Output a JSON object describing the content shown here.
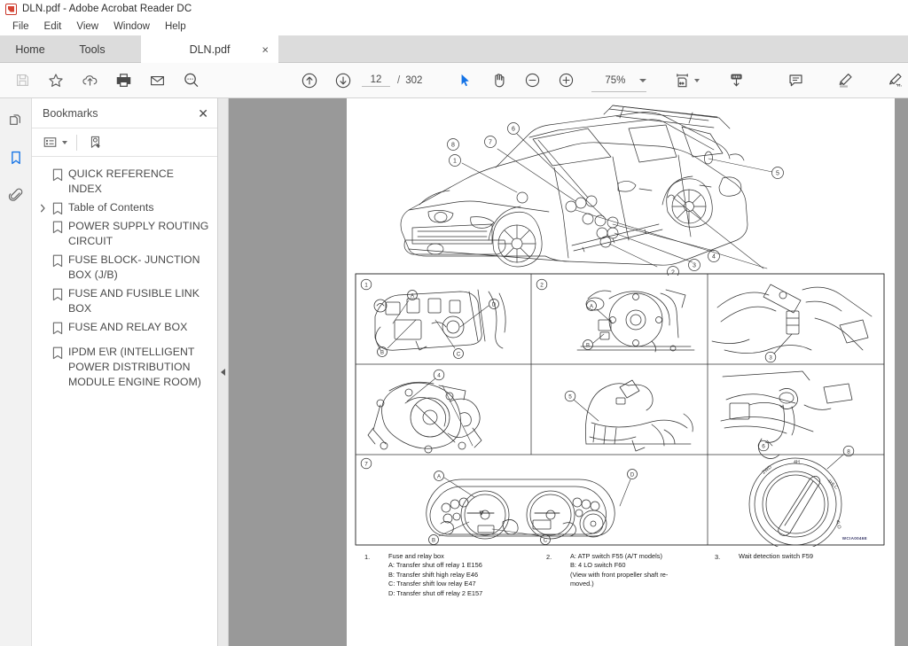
{
  "window": {
    "title": "DLN.pdf - Adobe Acrobat Reader DC",
    "app_icon": "pdf-icon"
  },
  "menubar": {
    "items": [
      {
        "label": "File"
      },
      {
        "label": "Edit"
      },
      {
        "label": "View"
      },
      {
        "label": "Window"
      },
      {
        "label": "Help"
      }
    ]
  },
  "tabs": {
    "home": "Home",
    "tools": "Tools",
    "document": "DLN.pdf",
    "close_glyph": "×"
  },
  "toolbar": {
    "left_icons": [
      {
        "name": "save-icon",
        "title": "Save File"
      },
      {
        "name": "star-icon",
        "title": "Add to Favorites"
      },
      {
        "name": "cloud-upload-icon",
        "title": "Save to Cloud"
      },
      {
        "name": "print-icon",
        "title": "Print File"
      },
      {
        "name": "email-icon",
        "title": "Send File by Email"
      },
      {
        "name": "search-icon",
        "title": "Find"
      }
    ],
    "prev_page": "previous-page-icon",
    "next_page": "next-page-icon",
    "page_current": "12",
    "page_separator": "/",
    "page_total": "302",
    "select_tool": "select-cursor-icon",
    "hand_tool": "hand-tool-icon",
    "zoom_out": "zoom-out-icon",
    "zoom_in": "zoom-in-icon",
    "zoom_level": "75%",
    "page_fit": "page-fit-icon",
    "scroll_mode": "scroll-mode-icon",
    "comment": "comment-icon",
    "highlight": "highlight-icon",
    "sign": "sign-icon",
    "fill_sign": "fill-and-sign-icon"
  },
  "navrail": {
    "items": [
      {
        "name": "page-thumbnails-icon",
        "label": "Page Thumbnails",
        "active": false
      },
      {
        "name": "bookmarks-icon",
        "label": "Bookmarks",
        "active": true
      },
      {
        "name": "attachments-icon",
        "label": "Attachments",
        "active": false
      }
    ]
  },
  "bookmarks_panel": {
    "title": "Bookmarks",
    "close_glyph": "✕",
    "options_icon": "bookmark-options-icon",
    "new_bookmark_icon": "new-bookmark-icon",
    "items": [
      {
        "label": "QUICK REFERENCE INDEX",
        "expandable": false
      },
      {
        "label": "Table of Contents",
        "expandable": true
      },
      {
        "label": "POWER SUPPLY ROUTING CIRCUIT",
        "expandable": false
      },
      {
        "label": "FUSE BLOCK- JUNCTION BOX (J/B)",
        "expandable": false
      },
      {
        "label": "FUSE AND FUSIBLE LINK BOX",
        "expandable": false
      },
      {
        "label": "FUSE AND RELAY BOX",
        "expandable": false
      },
      {
        "label": "IPDM E\\R (INTELLIGENT POWER DISTRIBUTION MODULE ENGINE ROOM)",
        "expandable": false
      }
    ],
    "collapse_handle": "panel-collapse-handle"
  },
  "document": {
    "figure_code": "WCIA0046E",
    "vehicle_callouts": [
      "1",
      "2",
      "3",
      "4",
      "5",
      "6",
      "7",
      "8"
    ],
    "grid_cells": [
      {
        "number": "1",
        "sublabels": [
          "A",
          "B",
          "C",
          "D"
        ]
      },
      {
        "number": "2",
        "sublabels": [
          "A",
          "B"
        ]
      },
      {
        "number": "3",
        "sublabels": []
      },
      {
        "number": "4",
        "sublabels": []
      },
      {
        "number": "5",
        "sublabels": []
      },
      {
        "number": "6",
        "sublabels": []
      },
      {
        "number": "7",
        "sublabels": [
          "A",
          "B",
          "C",
          "D"
        ]
      },
      {
        "number": "8",
        "sublabels": []
      }
    ],
    "caption": {
      "columns": [
        {
          "number": "1.",
          "lines": [
            "Fuse and relay box",
            "A: Transfer shut off relay 1 E156",
            "B: Transfer shift high relay E46",
            "C: Transfer shift low relay E47",
            "D: Transfer shut off relay 2 E157"
          ]
        },
        {
          "number": "2.",
          "lines": [
            "A: ATP switch F55 (A/T models)",
            "B: 4 LO switch F60",
            "(View with front propeller shaft re-",
            "moved.)"
          ]
        },
        {
          "number": "3.",
          "lines": [
            "Wait detection switch F59"
          ]
        }
      ]
    }
  },
  "colors": {
    "accent": "#1473e6",
    "toolbar_bg": "#fafafa",
    "tabbar_bg": "#dcdcdc",
    "viewer_bg": "#999999",
    "page_bg": "#ffffff",
    "icon_grey": "#5a5a5a",
    "text_grey": "#4a4a4a"
  }
}
